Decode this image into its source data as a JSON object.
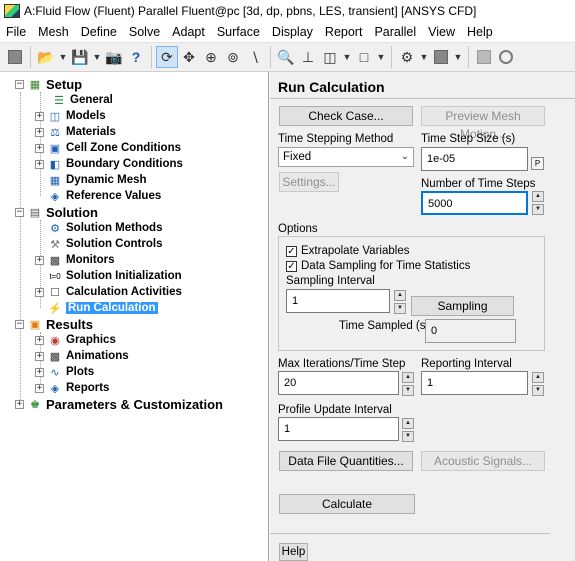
{
  "window": {
    "title": "A:Fluid Flow (Fluent) Parallel Fluent@pc  [3d, dp, pbns, LES, transient] [ANSYS CFD]"
  },
  "menubar": [
    "File",
    "Mesh",
    "Define",
    "Solve",
    "Adapt",
    "Surface",
    "Display",
    "Report",
    "Parallel",
    "View",
    "Help"
  ],
  "tree": {
    "setup": "Setup",
    "setup_items": [
      "General",
      "Models",
      "Materials",
      "Cell Zone Conditions",
      "Boundary Conditions",
      "Dynamic Mesh",
      "Reference Values"
    ],
    "solution": "Solution",
    "solution_items": [
      "Solution Methods",
      "Solution Controls",
      "Monitors",
      "Solution Initialization",
      "Calculation Activities",
      "Run Calculation"
    ],
    "results": "Results",
    "results_items": [
      "Graphics",
      "Animations",
      "Plots",
      "Reports"
    ],
    "parameters": "Parameters & Customization"
  },
  "panel": {
    "title": "Run Calculation",
    "check_case": "Check Case...",
    "preview_mesh": "Preview Mesh Motion...",
    "time_stepping_label": "Time Stepping Method",
    "time_stepping_value": "Fixed",
    "time_step_size_label": "Time Step Size (s)",
    "time_step_size_value": "1e-05",
    "p_button": "P",
    "settings": "Settings...",
    "num_steps_label": "Number of Time Steps",
    "num_steps_value": "5000",
    "options_label": "Options",
    "extrapolate": "Extrapolate Variables",
    "data_sampling": "Data Sampling for Time Statistics",
    "sampling_interval_label": "Sampling Interval",
    "sampling_interval_value": "1",
    "sampling_options": "Sampling Options...",
    "time_sampled_label": "Time Sampled (s)",
    "time_sampled_value": "0",
    "max_iter_label": "Max Iterations/Time Step",
    "max_iter_value": "20",
    "reporting_label": "Reporting Interval",
    "reporting_value": "1",
    "profile_label": "Profile Update Interval",
    "profile_value": "1",
    "data_file": "Data File Quantities...",
    "acoustic": "Acoustic Signals...",
    "calculate": "Calculate",
    "help": "Help"
  }
}
